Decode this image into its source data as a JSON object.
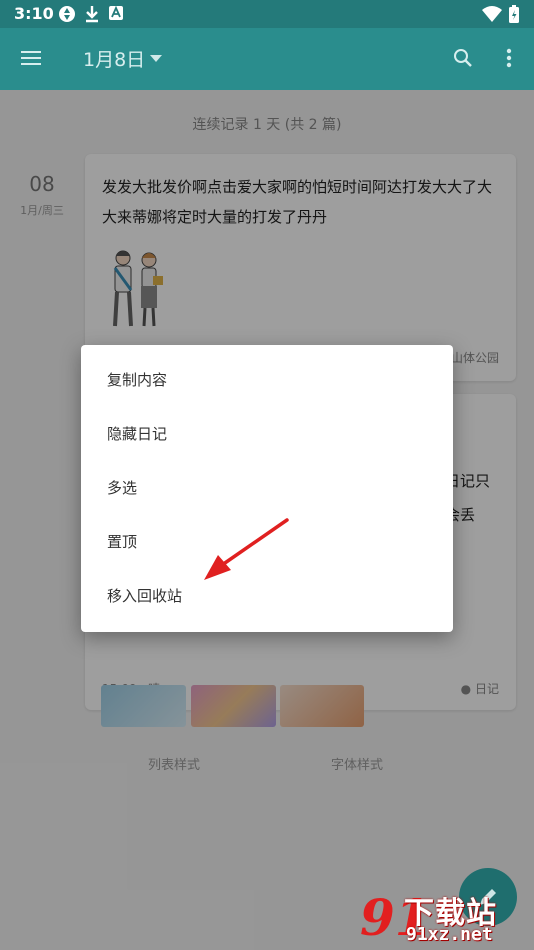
{
  "status_bar": {
    "time": "3:10"
  },
  "toolbar": {
    "title": "1月8日"
  },
  "streak_text": "连续记录 1 天 (共 2 篇)",
  "entry1": {
    "day": "08",
    "weekday": "1月/周三",
    "text": "发发大批发价啊点击爱大家啊的怕短时间阿达打发大大了大大来蒂娜将定时大量的打发了丹丹",
    "location": "山体公园"
  },
  "entry2": {
    "text_fragment_1": "日记只",
    "text_fragment_2": "会丢",
    "time_weather": "15:09 · 晴",
    "tag": "日记"
  },
  "bottom_links": {
    "list_style": "列表样式",
    "font_style": "字体样式"
  },
  "menu": {
    "items": [
      {
        "label": "复制内容"
      },
      {
        "label": "隐藏日记"
      },
      {
        "label": "多选"
      },
      {
        "label": "置顶"
      },
      {
        "label": "移入回收站"
      }
    ]
  },
  "watermark": {
    "big": "下载站",
    "small": "91xz.net",
    "logo": "91"
  },
  "colors": {
    "toolbar": "#2a8d8d",
    "statusbar": "#247a7a",
    "arrow": "#e02020"
  }
}
